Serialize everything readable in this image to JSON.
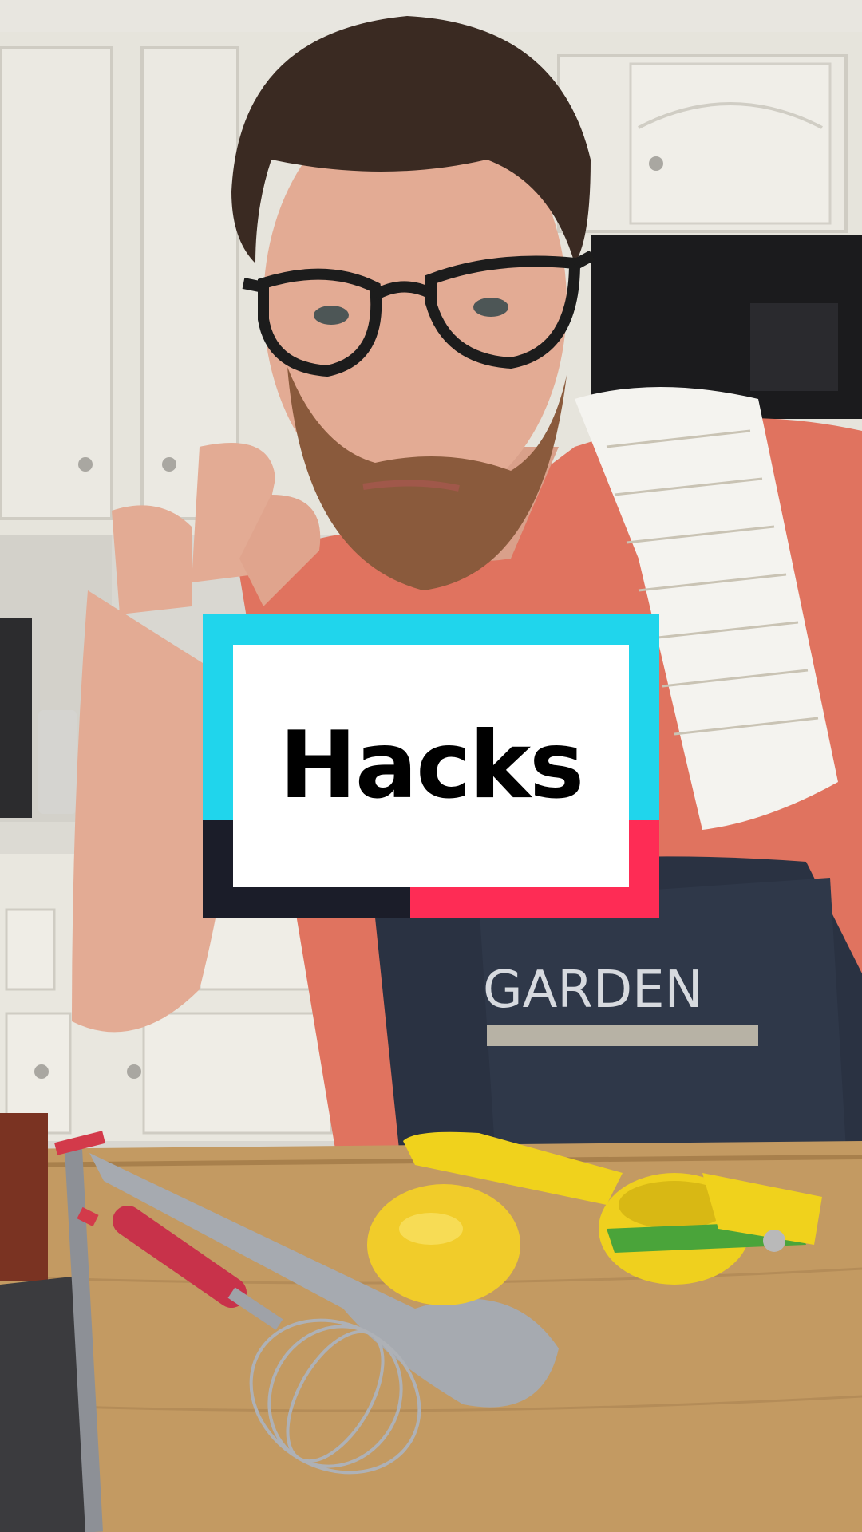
{
  "overlay": {
    "title": "Hacks",
    "colors": {
      "cyan": "#20d5ec",
      "red": "#fe2c55",
      "dark": "#1b1d29",
      "white": "#ffffff"
    }
  },
  "apron": {
    "print": "GARDEN"
  },
  "scene": {
    "description_icons": [
      "kitchen-cabinets",
      "microwave",
      "lemon",
      "citrus-squeezer",
      "whisk",
      "tongs",
      "cutting-board"
    ]
  }
}
